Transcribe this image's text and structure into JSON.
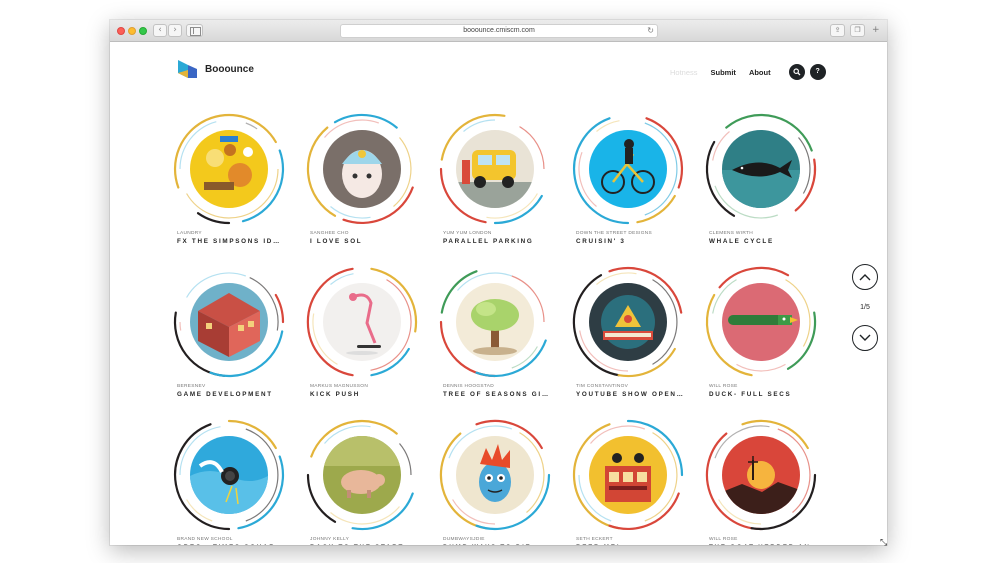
{
  "browser": {
    "url": "booounce.cmiscm.com",
    "icons": [
      "back-icon",
      "forward-icon",
      "sidebar-icon",
      "reload-icon",
      "share-icon",
      "tabs-icon",
      "new-tab-icon"
    ]
  },
  "header": {
    "brand": "Booounce",
    "nav": {
      "hot": "Hotness",
      "submit": "Submit",
      "about": "About"
    },
    "search_icon": "search-icon",
    "help_label": "?"
  },
  "pager": {
    "label": "1/5"
  },
  "items": [
    {
      "author": "LAUNDRY",
      "title": "FX THE SIMPSONS ID…",
      "thumb": "simpsons"
    },
    {
      "author": "SANGHEE CHO",
      "title": "I LOVE SOL",
      "thumb": "sol"
    },
    {
      "author": "YUM YUM LONDON",
      "title": "PARALLEL PARKING",
      "thumb": "parking"
    },
    {
      "author": "DOWN THE STREET DESIGNS",
      "title": "CRUISIN' 3",
      "thumb": "cruisin"
    },
    {
      "author": "CLEMENS WIRTH",
      "title": "WHALE CYCLE",
      "thumb": "whale"
    },
    {
      "author": "BERESNEV",
      "title": "GAME DEVELOPMENT",
      "thumb": "building"
    },
    {
      "author": "MARKUS MAGNUSSON",
      "title": "KICK PUSH",
      "thumb": "kickpush"
    },
    {
      "author": "DENNIS HOOGSTAD",
      "title": "TREE OF SEASONS GI…",
      "thumb": "tree"
    },
    {
      "author": "TIM CONSTANTINOV",
      "title": "YOUTUBE SHOW OPEN…",
      "thumb": "youtube"
    },
    {
      "author": "WILL ROSE",
      "title": "DUCK- FULL SECS",
      "thumb": "duck"
    },
    {
      "author": "BRAND NEW SCHOOL",
      "title": "OREO - TIMES SQUAR…",
      "thumb": "oreo"
    },
    {
      "author": "JOHNNY KELLY",
      "title": "BACK TO THE START",
      "thumb": "pig"
    },
    {
      "author": "DUMBWAYSJDIE",
      "title": "DUMB WAYS TO DIE",
      "thumb": "dumbways"
    },
    {
      "author": "SETH ECKERT",
      "title": "BEER ME!",
      "thumb": "beer"
    },
    {
      "author": "WILL ROSE",
      "title": "THE GOAT HERDER AN…",
      "thumb": "goat"
    }
  ],
  "colors": {
    "ring_palette": [
      "#e3b43a",
      "#2ba9d6",
      "#d9473b",
      "#3f9b58",
      "#231f20"
    ]
  }
}
